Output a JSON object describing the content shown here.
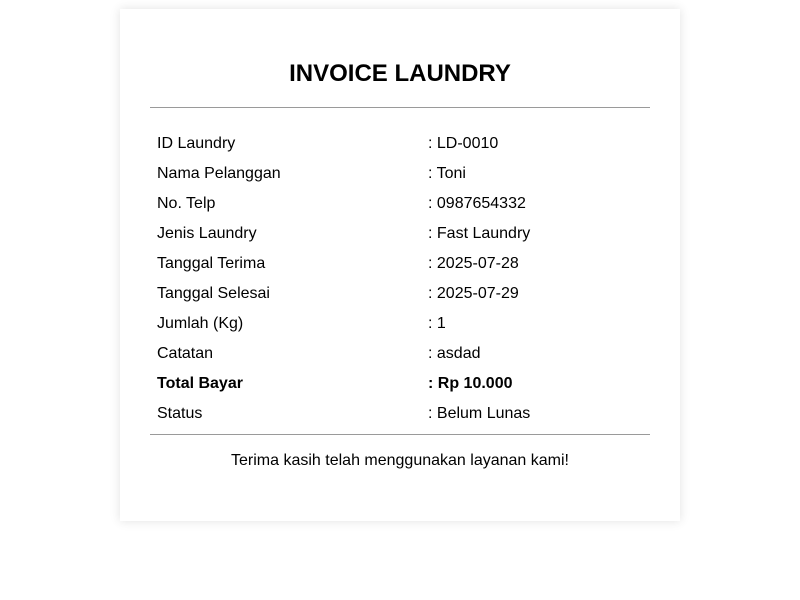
{
  "invoice": {
    "title": "INVOICE LAUNDRY",
    "rows": [
      {
        "label": "ID Laundry",
        "value": ": LD-0010"
      },
      {
        "label": "Nama Pelanggan",
        "value": ": Toni"
      },
      {
        "label": "No. Telp",
        "value": ": 0987654332"
      },
      {
        "label": "Jenis Laundry",
        "value": ": Fast Laundry"
      },
      {
        "label": "Tanggal Terima",
        "value": ": 2025-07-28"
      },
      {
        "label": "Tanggal Selesai",
        "value": ": 2025-07-29"
      },
      {
        "label": "Jumlah (Kg)",
        "value": ": 1"
      },
      {
        "label": "Catatan",
        "value": ": asdad"
      },
      {
        "label": "Total Bayar",
        "value": ": Rp 10.000"
      },
      {
        "label": "Status",
        "value": ": Belum Lunas"
      }
    ],
    "footer_message": "Terima kasih telah menggunakan layanan kami!"
  },
  "colors": {
    "text": "#000000",
    "divider": "#9a9a9a",
    "background": "#ffffff"
  }
}
